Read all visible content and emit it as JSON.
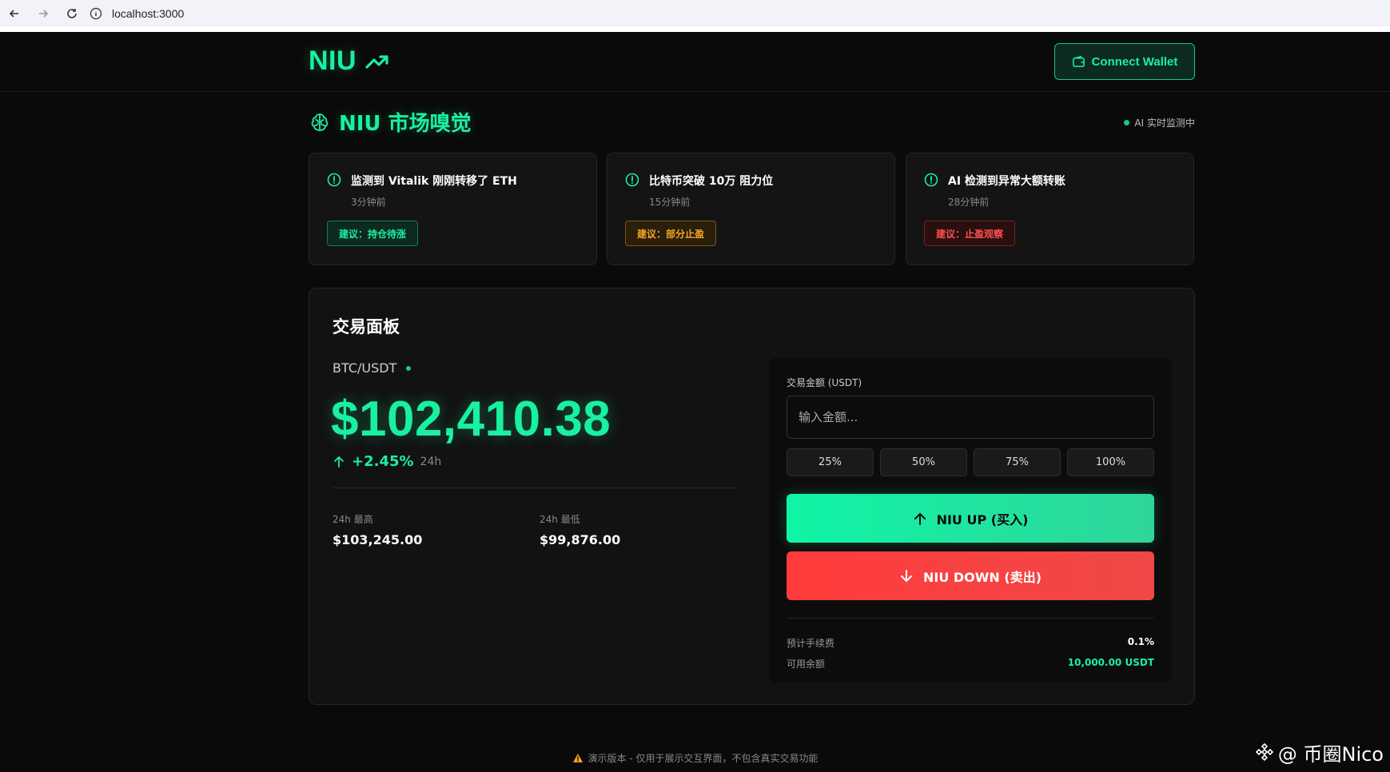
{
  "browser": {
    "url": "localhost:3000"
  },
  "header": {
    "logo": "NIU",
    "connect_label": "Connect Wallet"
  },
  "sniff": {
    "title": "NIU 市场嗅觉",
    "live_label": "AI 实时监测中",
    "cards": [
      {
        "title": "监测到 Vitalik 刚刚转移了 ETH",
        "time": "3分钟前",
        "badge": "建议：持仓待涨",
        "badge_color": "#19f0a0"
      },
      {
        "title": "比特币突破 10万 阻力位",
        "time": "15分钟前",
        "badge": "建议：部分止盈",
        "badge_color": "#f5a623"
      },
      {
        "title": "AI 检测到异常大额转账",
        "time": "28分钟前",
        "badge": "建议：止盈观察",
        "badge_color": "#ff5050"
      }
    ]
  },
  "panel": {
    "title": "交易面板",
    "pair": "BTC/USDT",
    "price": "$102,410.38",
    "change": "+2.45%",
    "change_period": "24h",
    "high_label": "24h 最高",
    "high_value": "$103,245.00",
    "low_label": "24h 最低",
    "low_value": "$99,876.00"
  },
  "trade": {
    "amount_label": "交易金额 (USDT)",
    "amount_placeholder": "输入金额...",
    "pcts": [
      "25%",
      "50%",
      "75%",
      "100%"
    ],
    "buy_label": "NIU UP (买入)",
    "sell_label": "NIU DOWN (卖出)",
    "fee_label": "预计手续费",
    "fee_value": "0.1%",
    "balance_label": "可用余额",
    "balance_value": "10,000.00 USDT"
  },
  "footer": {
    "notice": "演示版本 - 仅用于展示交互界面，不包含真实交易功能"
  },
  "watermark": {
    "text": "@ 币圈Nico"
  },
  "colors": {
    "accent": "#19f0a0",
    "danger": "#ff3b3b",
    "warning": "#f5a623",
    "background": "#0a0a0a"
  }
}
